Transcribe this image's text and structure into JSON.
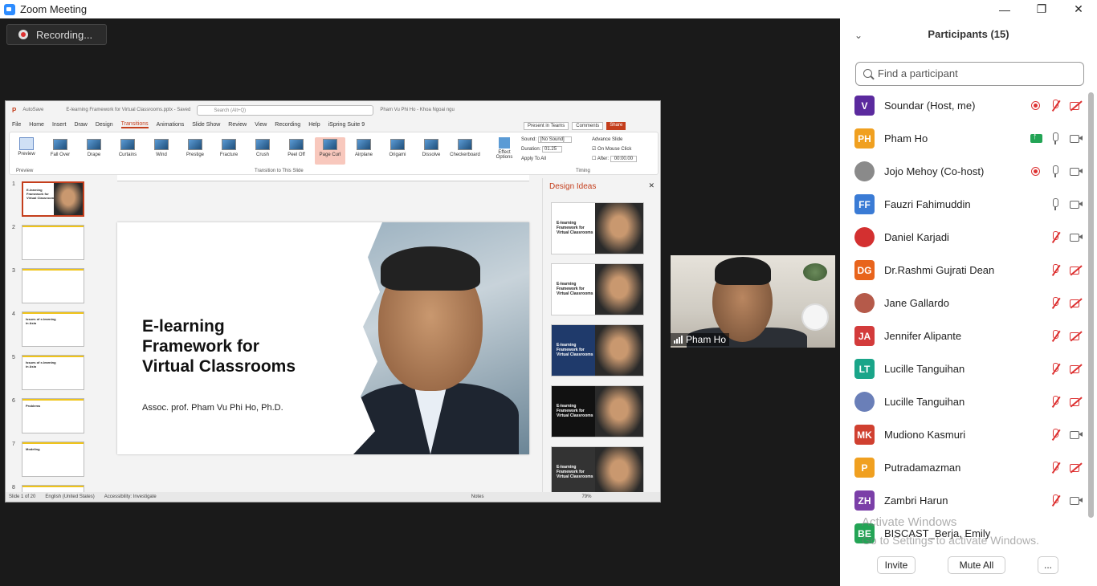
{
  "window": {
    "title": "Zoom Meeting"
  },
  "controls": {
    "minimize": "—",
    "restore": "❐",
    "close": "✕"
  },
  "recording": {
    "label": "Recording..."
  },
  "ppt": {
    "autosave": "AutoSave",
    "filename": "E-learning Framework for Virtual Classrooms.pptx - Saved",
    "search": "Search (Alt+Q)",
    "user": "Pham Vu Phi Ho - Khoa Ngoai ngu",
    "menu": [
      "File",
      "Home",
      "Insert",
      "Draw",
      "Design",
      "Transitions",
      "Animations",
      "Slide Show",
      "Review",
      "View",
      "Recording",
      "Help",
      "iSpring Suite 9"
    ],
    "active_menu": "Transitions",
    "present_teams": "Present in Teams",
    "comments": "Comments",
    "share": "Share",
    "preview": "Preview",
    "transitions": [
      "Fall Over",
      "Drape",
      "Curtains",
      "Wind",
      "Prestige",
      "Fracture",
      "Crush",
      "Peel Off",
      "Page Curl",
      "Airplane",
      "Origami",
      "Dissolve",
      "Checkerboard"
    ],
    "selected_transition": "Page Curl",
    "effect_options": "Effect Options",
    "group_label": "Transition to This Slide",
    "preview_group": "Preview",
    "timing_group": "Timing",
    "sound_label": "Sound:",
    "sound_value": "[No Sound]",
    "duration_label": "Duration:",
    "duration_value": "01.25",
    "apply_all": "Apply To All",
    "advance": "Advance Slide",
    "on_click": "On Mouse Click",
    "after_label": "After:",
    "after_value": "00:00.00",
    "slide_title": "E-learning Framework for Virtual Classrooms",
    "slide_sub": "Assoc. prof. Pham Vu Phi Ho, Ph.D.",
    "design_ideas": "Design Ideas",
    "status_slide": "Slide 1 of 20",
    "status_lang": "English (United States)",
    "status_access": "Accessibility: Investigate",
    "status_notes": "Notes",
    "zoom": "79%",
    "slide_numbers": [
      "1",
      "2",
      "3",
      "4",
      "5",
      "6",
      "7",
      "8"
    ],
    "thumb_titles": [
      "E-learning Framework for Virtual Classrooms",
      "",
      "",
      "Issues of e-learning in Asia",
      "Issues of e-learning in Asia",
      "Problems",
      "Modeling",
      ""
    ],
    "design_thumb_titles": [
      "E-learning Framework for Virtual Classrooms",
      "E-learning Framework for Virtual Classrooms",
      "E-learning Framework for Virtual Classrooms",
      "E-learning Framework for Virtual Classrooms",
      "E-learning Framework for Virtual Classrooms"
    ]
  },
  "video": {
    "name": "Pham Ho"
  },
  "participants": {
    "title": "Participants (15)",
    "search_placeholder": "Find a participant",
    "list": [
      {
        "initials": "V",
        "name": "Soundar (Host, me)",
        "color": "#5b2a9e",
        "rec": true,
        "share": false,
        "mic": "off",
        "cam": "off"
      },
      {
        "initials": "PH",
        "name": "Pham Ho",
        "color": "#f0a020",
        "rec": false,
        "share": true,
        "mic": "on",
        "cam": "on"
      },
      {
        "initials": "",
        "name": "Jojo Mehoy (Co-host)",
        "color": "#8a8a8a",
        "rec": true,
        "share": false,
        "mic": "on",
        "cam": "on"
      },
      {
        "initials": "FF",
        "name": "Fauzri Fahimuddin",
        "color": "#3a7bd5",
        "rec": false,
        "share": false,
        "mic": "on",
        "cam": "on"
      },
      {
        "initials": "",
        "name": "Daniel Karjadi",
        "color": "#d33030",
        "rec": false,
        "share": false,
        "mic": "off",
        "cam": "on"
      },
      {
        "initials": "DG",
        "name": "Dr.Rashmi Gujrati Dean",
        "color": "#e8641c",
        "rec": false,
        "share": false,
        "mic": "off",
        "cam": "off"
      },
      {
        "initials": "",
        "name": "Jane Gallardo",
        "color": "#b55a4a",
        "rec": false,
        "share": false,
        "mic": "off",
        "cam": "off"
      },
      {
        "initials": "JA",
        "name": "Jennifer Alipante",
        "color": "#d33b3b",
        "rec": false,
        "share": false,
        "mic": "off",
        "cam": "off"
      },
      {
        "initials": "LT",
        "name": "Lucille Tanguihan",
        "color": "#1aa589",
        "rec": false,
        "share": false,
        "mic": "off",
        "cam": "off"
      },
      {
        "initials": "",
        "name": "Lucille Tanguihan",
        "color": "#6a7fb8",
        "rec": false,
        "share": false,
        "mic": "off",
        "cam": "off"
      },
      {
        "initials": "MK",
        "name": "Mudiono Kasmuri",
        "color": "#d04030",
        "rec": false,
        "share": false,
        "mic": "off",
        "cam": "on"
      },
      {
        "initials": "P",
        "name": "Putradamazman",
        "color": "#f0a020",
        "rec": false,
        "share": false,
        "mic": "off",
        "cam": "off"
      },
      {
        "initials": "ZH",
        "name": "Zambri Harun",
        "color": "#7b3fa8",
        "rec": false,
        "share": false,
        "mic": "off",
        "cam": "on"
      },
      {
        "initials": "BE",
        "name": "BISCAST_Berja, Emily",
        "color": "#23a455",
        "rec": false,
        "share": false,
        "mic": "",
        "cam": ""
      }
    ],
    "invite": "Invite",
    "mute_all": "Mute All",
    "more": "..."
  },
  "watermark": {
    "line1": "Activate Windows",
    "line2": "Go to Settings to activate Windows."
  }
}
